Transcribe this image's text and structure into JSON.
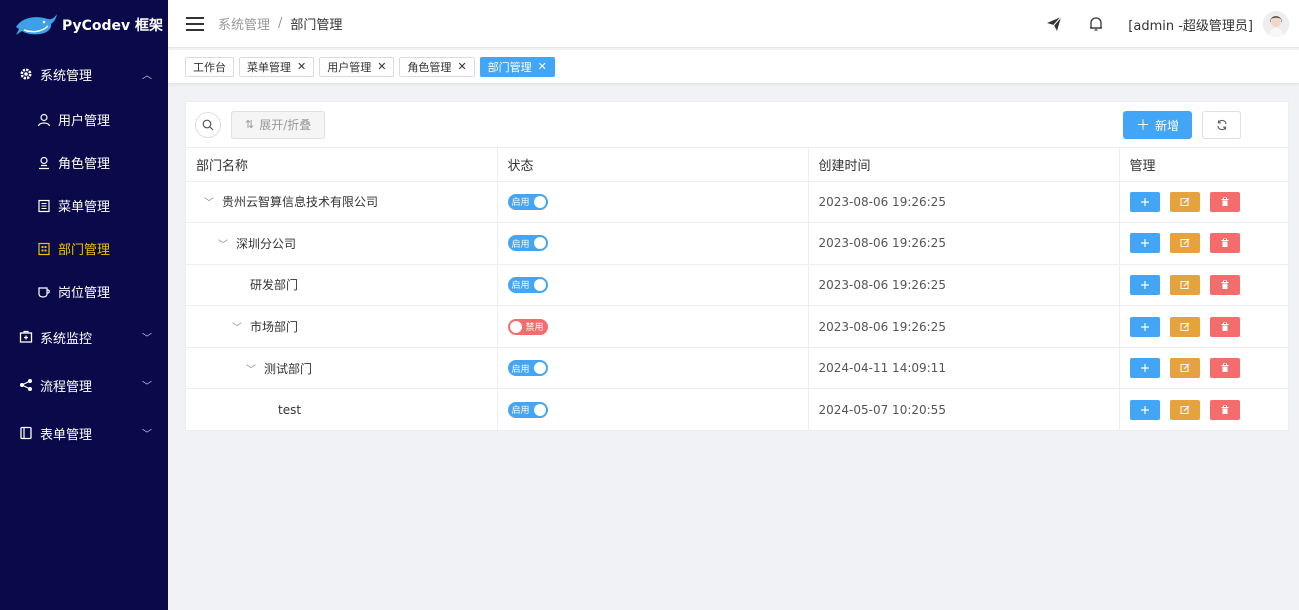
{
  "app": {
    "logo_text": "PyCodev 框架"
  },
  "sidebar": {
    "system_group": {
      "label": "系统管理",
      "icon": "gear-icon"
    },
    "items": [
      {
        "label": "用户管理",
        "icon": "user-icon"
      },
      {
        "label": "角色管理",
        "icon": "role-icon"
      },
      {
        "label": "菜单管理",
        "icon": "menu-list-icon"
      },
      {
        "label": "部门管理",
        "icon": "department-icon"
      },
      {
        "label": "岗位管理",
        "icon": "post-icon"
      }
    ],
    "groups": [
      {
        "label": "系统监控",
        "icon": "monitor-icon"
      },
      {
        "label": "流程管理",
        "icon": "share-icon"
      },
      {
        "label": "表单管理",
        "icon": "form-icon"
      }
    ]
  },
  "header": {
    "breadcrumb": [
      "系统管理",
      "/",
      "部门管理"
    ],
    "user": "[admin -超级管理员]"
  },
  "tags": [
    {
      "label": "工作台",
      "closable": false
    },
    {
      "label": "菜单管理",
      "closable": true
    },
    {
      "label": "用户管理",
      "closable": true
    },
    {
      "label": "角色管理",
      "closable": true
    },
    {
      "label": "部门管理",
      "closable": true
    }
  ],
  "toolbar": {
    "expand_label": "展开/折叠",
    "add_label": "新增"
  },
  "table": {
    "columns": [
      "部门名称",
      "状态",
      "创建时间",
      "管理"
    ],
    "rows": [
      {
        "name": "贵州云智算信息技术有限公司",
        "level": 0,
        "expanded": true,
        "status": "启用",
        "enabled": true,
        "created": "2023-08-06 19:26:25"
      },
      {
        "name": "深圳分公司",
        "level": 1,
        "expanded": true,
        "status": "启用",
        "enabled": true,
        "created": "2023-08-06 19:26:25"
      },
      {
        "name": "研发部门",
        "level": 2,
        "expanded": false,
        "status": "启用",
        "enabled": true,
        "created": "2023-08-06 19:26:25"
      },
      {
        "name": "市场部门",
        "level": 2,
        "expanded": true,
        "status": "禁用",
        "enabled": false,
        "created": "2023-08-06 19:26:25"
      },
      {
        "name": "测试部门",
        "level": 3,
        "expanded": true,
        "status": "启用",
        "enabled": true,
        "created": "2024-04-11 14:09:11"
      },
      {
        "name": "test",
        "level": 4,
        "expanded": false,
        "status": "启用",
        "enabled": true,
        "created": "2024-05-07 10:20:55"
      }
    ]
  }
}
